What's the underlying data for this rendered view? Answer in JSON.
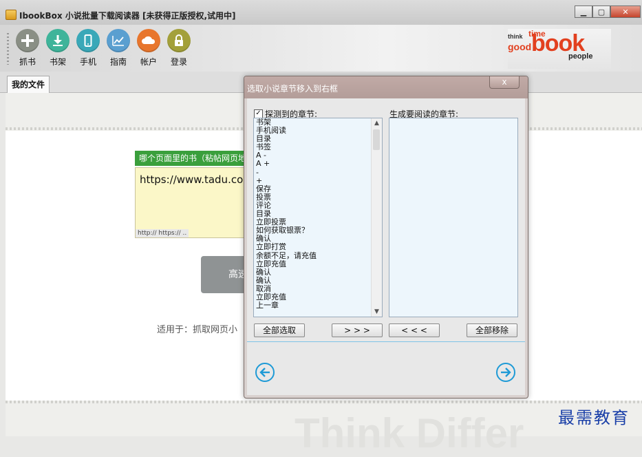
{
  "window": {
    "title": "IbookBox 小说批量下载阅读器 [未获得正版授权,试用中]"
  },
  "toolbar": {
    "items": [
      {
        "label": "抓书",
        "icon": "plus-icon",
        "color": "#8a8f85"
      },
      {
        "label": "书架",
        "icon": "download-icon",
        "color": "#3fb49a"
      },
      {
        "label": "手机",
        "icon": "phone-icon",
        "color": "#3aa8b8"
      },
      {
        "label": "指南",
        "icon": "chart-icon",
        "color": "#5a9fd0"
      },
      {
        "label": "帐户",
        "icon": "cloud-icon",
        "color": "#e8762d"
      },
      {
        "label": "登录",
        "icon": "lock-icon",
        "color": "#a3a03a"
      }
    ],
    "logo_text": "book",
    "logo_words": [
      "time",
      "good",
      "think",
      "people"
    ]
  },
  "tabs": {
    "active": "我的文件"
  },
  "main": {
    "url_label": "哪个页面里的书（粘帖网页地址",
    "url_value": "https://www.tadu.com/",
    "url_hint": "http:// https:// ..",
    "fast_button": "高速",
    "applies_text": "适用于：抓取网页小",
    "watermark": "Think Differ"
  },
  "dialog": {
    "title": "选取小说章节移入到右框",
    "close_symbol": "x",
    "left_label": "探测到的章节:",
    "left_checked": true,
    "right_label": "生成要阅读的章节:",
    "chapters": [
      "书架",
      "手机阅读",
      "目录",
      "书签",
      "A -",
      "A +",
      "-",
      "+",
      "保存",
      "投票",
      "评论",
      "目录",
      "立即投票",
      "如何获取银票？",
      "确认",
      "立即打赏",
      "余额不足，请充值",
      "立即充值",
      "确认",
      "确认",
      "取消",
      "立即充值",
      "上一章"
    ],
    "buttons": {
      "select_all": "全部选取",
      "move_right": "> > >",
      "move_left": "< < <",
      "remove_all": "全部移除"
    }
  },
  "brand_text": "最需教育"
}
